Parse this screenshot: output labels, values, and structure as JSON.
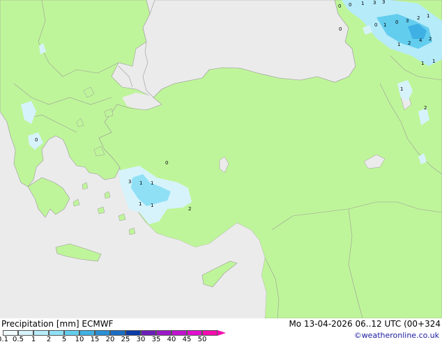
{
  "map": {
    "sea_color": "#ebebeb",
    "land_color": "#bff59a",
    "outside_color": "#e6e6e6",
    "point_labels": [
      "0",
      "0",
      "1",
      "3",
      "3",
      "0",
      "1",
      "2",
      "1",
      "0",
      "0",
      "1",
      "3",
      "2",
      "1",
      "1",
      "2",
      "4",
      "2",
      "1",
      "1",
      "1",
      "2",
      "0",
      "0",
      "3",
      "1",
      "1",
      "1",
      "1",
      "2"
    ]
  },
  "footer": {
    "title": "Precipitation [mm]  ECMWF",
    "date": "Mo 13-04-2026 06..12 UTC (00+324",
    "credit": "©weatheronline.co.uk"
  },
  "legend": {
    "ticks": [
      "0.1",
      "0.5",
      "1",
      "2",
      "5",
      "10",
      "15",
      "20",
      "25",
      "30",
      "35",
      "40",
      "45",
      "50"
    ],
    "colors": [
      "#f0fbff",
      "#d6f3fc",
      "#b6ebfa",
      "#8fe0f5",
      "#63cdee",
      "#3fb0e4",
      "#2a8fd6",
      "#1c6ec4",
      "#0c3ba8",
      "#6a1fb8",
      "#9b19c8",
      "#c214d0",
      "#e20fcf",
      "#f50cb0"
    ]
  }
}
